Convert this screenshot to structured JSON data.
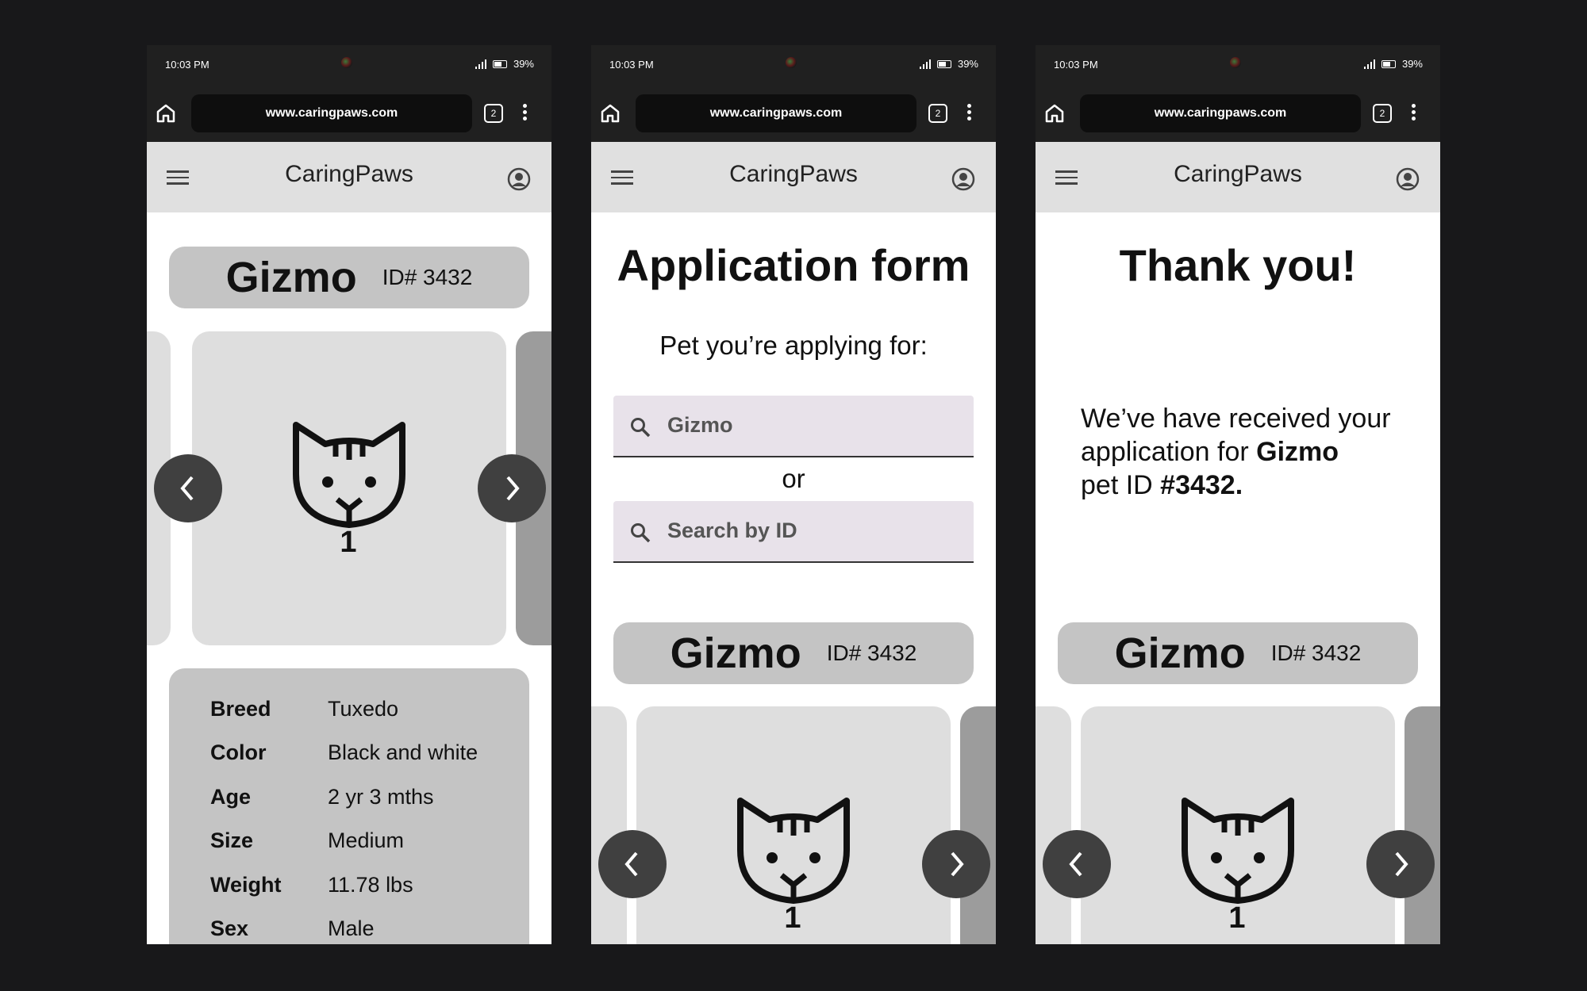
{
  "status": {
    "time": "10:03 PM",
    "battery": "39%"
  },
  "browser": {
    "url": "www.caringpaws.com",
    "tab_count": "2"
  },
  "app": {
    "title": "CaringPaws"
  },
  "pet": {
    "name": "Gizmo",
    "id_label": "ID# 3432"
  },
  "carousel": {
    "slide_number": "1"
  },
  "details": [
    {
      "label": "Breed",
      "value": "Tuxedo"
    },
    {
      "label": "Color",
      "value": "Black and white"
    },
    {
      "label": "Age",
      "value": "2 yr 3 mths"
    },
    {
      "label": "Size",
      "value": "Medium"
    },
    {
      "label": "Weight",
      "value": "11.78 lbs"
    },
    {
      "label": "Sex",
      "value": "Male"
    }
  ],
  "application": {
    "heading": "Application form",
    "subheading": "Pet you’re applying for:",
    "name_search_value": "Gizmo",
    "or_text": "or",
    "id_search_placeholder": "Search by ID"
  },
  "confirmation": {
    "heading": "Thank you!",
    "line1": "We’ve have received your",
    "line2_prefix": "application for ",
    "line2_pet": "Gizmo",
    "line3_prefix": "pet ID ",
    "line3_id": "#3432."
  },
  "icons": [
    "home-icon",
    "tab-switcher-icon",
    "more-vert-icon",
    "menu-icon",
    "account-circle-icon",
    "cat-icon",
    "chevron-left-icon",
    "chevron-right-icon",
    "search-icon"
  ]
}
